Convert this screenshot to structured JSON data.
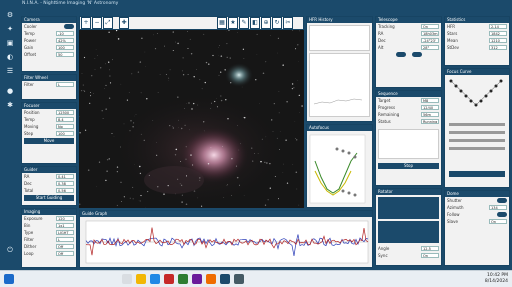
{
  "window": {
    "title": "N.I.N.A. - Nighttime Imaging 'N' Astronomy"
  },
  "toolstrip": {
    "icons": [
      "equipment-icon",
      "sky-atlas-icon",
      "framing-icon",
      "flat-wizard-icon",
      "sequencer-icon",
      "imaging-icon",
      "options-icon",
      "power-icon"
    ]
  },
  "left_panels": {
    "camera": {
      "title": "Camera",
      "rows": [
        {
          "label": "Cooler",
          "value": "On"
        },
        {
          "label": "Temp",
          "value": "-10"
        },
        {
          "label": "Power",
          "value": "42%"
        },
        {
          "label": "Gain",
          "value": "100"
        },
        {
          "label": "Offset",
          "value": "50"
        }
      ]
    },
    "filter": {
      "title": "Filter Wheel",
      "rows": [
        {
          "label": "Filter",
          "value": "L"
        }
      ]
    },
    "focuser": {
      "title": "Focuser",
      "rows": [
        {
          "label": "Position",
          "value": "12500"
        },
        {
          "label": "Temp",
          "value": "8.4"
        },
        {
          "label": "Moving",
          "value": "No"
        },
        {
          "label": "Step",
          "value": "100"
        }
      ],
      "button": "Move"
    },
    "guider": {
      "title": "Guider",
      "rows": [
        {
          "label": "RA",
          "value": "0.41"
        },
        {
          "label": "Dec",
          "value": "0.38"
        },
        {
          "label": "Total",
          "value": "0.56"
        }
      ],
      "button": "Start Guiding"
    },
    "imaging": {
      "title": "Imaging",
      "rows": [
        {
          "label": "Exposure",
          "value": "120"
        },
        {
          "label": "Bin",
          "value": "1x1"
        },
        {
          "label": "Type",
          "value": "LIGHT"
        },
        {
          "label": "Filter",
          "value": "L"
        },
        {
          "label": "Dither",
          "value": "Off"
        },
        {
          "label": "Loop",
          "value": "Off"
        }
      ]
    }
  },
  "image_tools": [
    "zoom-in-icon",
    "zoom-out-icon",
    "fit-icon",
    "crosshair-icon",
    "grid-icon",
    "star-icon",
    "annotate-icon",
    "stretch-icon",
    "plate-solve-icon",
    "rotate-icon",
    "crop-icon"
  ],
  "image": {
    "target": "M8 Lagoon Nebula"
  },
  "right_panels": {
    "hfr": {
      "title": "HFR History"
    },
    "telescope": {
      "title": "Telescope",
      "rows": [
        {
          "label": "Tracking",
          "value": "On"
        },
        {
          "label": "RA",
          "value": "18h03m"
        },
        {
          "label": "Dec",
          "value": "-24°23'"
        },
        {
          "label": "Alt",
          "value": "28°"
        }
      ]
    },
    "autofocus": {
      "title": "Autofocus"
    },
    "sequence": {
      "title": "Sequence",
      "rows": [
        {
          "label": "Target",
          "value": "M8"
        },
        {
          "label": "Progress",
          "value": "12/40"
        },
        {
          "label": "Remaining",
          "value": "56m"
        },
        {
          "label": "Status",
          "value": "Running"
        }
      ],
      "button": "Stop"
    },
    "stats": {
      "title": "Statistics",
      "rows": [
        {
          "label": "HFR",
          "value": "2.14"
        },
        {
          "label": "Stars",
          "value": "1842"
        },
        {
          "label": "Mean",
          "value": "1210"
        },
        {
          "label": "StDev",
          "value": "312"
        }
      ]
    },
    "curve": {
      "title": "Focus Curve"
    },
    "rotator": {
      "title": "Rotator",
      "rows": [
        {
          "label": "Angle",
          "value": "12.5"
        },
        {
          "label": "Sync",
          "value": "On"
        }
      ]
    },
    "dome": {
      "title": "Dome",
      "rows": [
        {
          "label": "Shutter",
          "value": "Open"
        },
        {
          "label": "Azimuth",
          "value": "134"
        },
        {
          "label": "Follow",
          "value": "On"
        },
        {
          "label": "Slave",
          "value": "On"
        }
      ]
    }
  },
  "guide_graph": {
    "title": "Guide Graph",
    "legend": [
      "RA",
      "Dec"
    ],
    "colors": {
      "ra": "#2b3db8",
      "dec": "#b22222"
    }
  },
  "taskbar": {
    "time": "10:42 PM",
    "date": "8/14/2024"
  }
}
